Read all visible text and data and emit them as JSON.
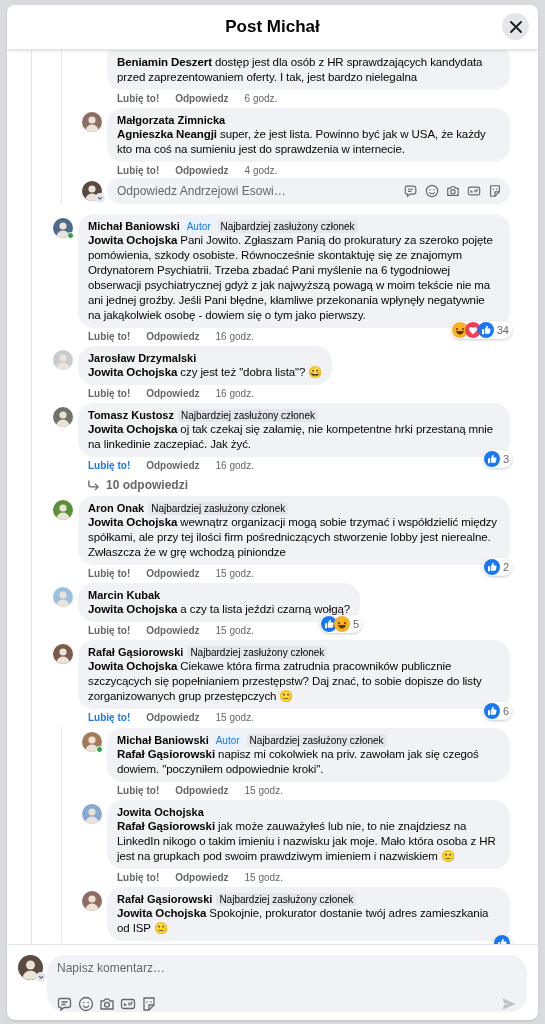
{
  "dialog": {
    "title": "Post Michał"
  },
  "thread_top": {
    "replies": [
      {
        "text": "**Beniamin Deszert** dostęp jest dla osób z HR sprawdzających kandydata przed zaprezentowaniem oferty. I tak, jest bardzo nielegalna",
        "like_label": "Lubię to!",
        "liked": false,
        "reply_label": "Odpowiedz",
        "time": "6 godz."
      },
      {
        "author": "Małgorzata Zimnicka",
        "text": "**Agnieszka Neangji** super, że jest lista. Powinno być jak w USA, że każdy kto ma coś na sumieniu jest do sprawdzenia w internecie.",
        "like_label": "Lubię to!",
        "liked": false,
        "reply_label": "Odpowiedz",
        "time": "4 godz."
      }
    ],
    "reply_field": {
      "placeholder": "Odpowiedz Andrzejowi Esowi…"
    }
  },
  "comments": [
    {
      "author": "Michał Baniowski",
      "online": true,
      "badges": [
        {
          "label": "Autor",
          "kind": "author"
        },
        {
          "label": "Najbardziej zasłużony członek",
          "kind": "top_member"
        }
      ],
      "text": "**Jowita Ochojska** Pani Jowito. Zgłaszam Panią do prokuratury za szeroko pojęte pomówienia, szkody osobiste. Równocześnie skontaktuję się ze znajomym Ordynatorem Psychiatrii. Trzeba zbadać Pani myślenie na 6 tygodniowej obserwacji psychiatrycznej gdyż z jak najwyższą powagą w moim tekście nie ma ani jednej groźby. Jeśli Pani błędne, kłamliwe przekonania wpłynęły negatywnie na jakąkolwiek osobę - dowiem się o tym jako pierwszy.",
      "reactions": {
        "icons": [
          {
            "kind": "haha"
          },
          {
            "kind": "love"
          },
          {
            "kind": "like"
          }
        ],
        "count": "34"
      },
      "like_label": "Lubię to!",
      "liked": false,
      "reply_label": "Odpowiedz",
      "time": "16 godz."
    },
    {
      "author": "Jarosław Drzymalski",
      "text": "**Jowita Ochojska** czy jest też \"dobra lista\"? 😀",
      "like_label": "Lubię to!",
      "liked": false,
      "reply_label": "Odpowiedz",
      "time": "16 godz."
    },
    {
      "author": "Tomasz Kustosz",
      "badges": [
        {
          "label": "Najbardziej zasłużony członek",
          "kind": "top_member"
        }
      ],
      "text": "**Jowita Ochojska** oj tak czekaj się załamię, nie kompetentne hrki przestaną mnie na linkedinie zaczepiać. Jak żyć.",
      "reactions": {
        "icons": [
          {
            "kind": "like"
          }
        ],
        "count": "3"
      },
      "like_label": "Lubię to!",
      "liked": true,
      "reply_label": "Odpowiedz",
      "time": "16 godz.",
      "more_replies": "10 odpowiedzi"
    },
    {
      "author": "Aron Onak",
      "badges": [
        {
          "label": "Najbardziej zasłużony członek",
          "kind": "top_member"
        }
      ],
      "text": "**Jowita Ochojska** wewnątrz organizacji mogą sobie trzymać i współdzielić między spółkami, ale przy tej ilości firm pośredniczących stworzenie lobby jest nierealne. Zwłaszcza że w grę wchodzą piniondze",
      "reactions": {
        "icons": [
          {
            "kind": "like"
          }
        ],
        "count": "2"
      },
      "like_label": "Lubię to!",
      "liked": false,
      "reply_label": "Odpowiedz",
      "time": "15 godz."
    },
    {
      "author": "Marcin Kubak",
      "text": "**Jowita Ochojska** a czy ta lista jeździ czarną wołgą?",
      "reactions": {
        "icons": [
          {
            "kind": "like"
          },
          {
            "kind": "haha"
          }
        ],
        "count": "5"
      },
      "like_label": "Lubię to!",
      "liked": false,
      "reply_label": "Odpowiedz",
      "time": "15 godz."
    },
    {
      "author": "Rafał Gąsiorowski",
      "badges": [
        {
          "label": "Najbardziej zasłużony członek",
          "kind": "top_member"
        }
      ],
      "text": "**Jowita Ochojska** Ciekawe która firma zatrudnia pracowników publicznie szczycących się popełnianiem przestępstw? Daj znać, to sobie dopisze do listy zorganizowanych grup przestępczych 🙂",
      "reactions": {
        "icons": [
          {
            "kind": "like"
          }
        ],
        "count": "6"
      },
      "like_label": "Lubię to!",
      "liked": true,
      "reply_label": "Odpowiedz",
      "time": "15 godz.",
      "children": [
        {
          "author": "Michał Baniowski",
          "online": true,
          "badges": [
            {
              "label": "Autor",
              "kind": "author"
            },
            {
              "label": "Najbardziej zasłużony członek",
              "kind": "top_member"
            }
          ],
          "text": "**Rafał Gąsiorowski** napisz mi cokolwiek na priv. zawołam jak się czegoś dowiem. \"poczyniłem odpowiednie kroki\".",
          "like_label": "Lubię to!",
          "liked": false,
          "reply_label": "Odpowiedz",
          "time": "15 godz."
        },
        {
          "author": "Jowita Ochojska",
          "text": "**Rafał Gąsiorowski** jak może zauważyłeś lub nie, to nie znajdziesz na LinkedIn nikogo o takim imieniu i nazwisku jak moje. Mało która osoba z HR jest na grupkach pod swoim prawdziwym imieniem i nazwiskiem 🙂",
          "like_label": "Lubię to!",
          "liked": false,
          "reply_label": "Odpowiedz",
          "time": "15 godz."
        },
        {
          "author": "Rafał Gąsiorowski",
          "badges": [
            {
              "label": "Najbardziej zasłużony członek",
              "kind": "top_member"
            }
          ],
          "text": "**Jowita Ochojska** Spokojnie, prokurator dostanie twój adres zamieszkania od ISP 🙂",
          "reactions": {
            "icons": [
              {
                "kind": "like"
              }
            ]
          }
        }
      ]
    }
  ],
  "composer": {
    "placeholder": "Napisz komentarz…"
  }
}
